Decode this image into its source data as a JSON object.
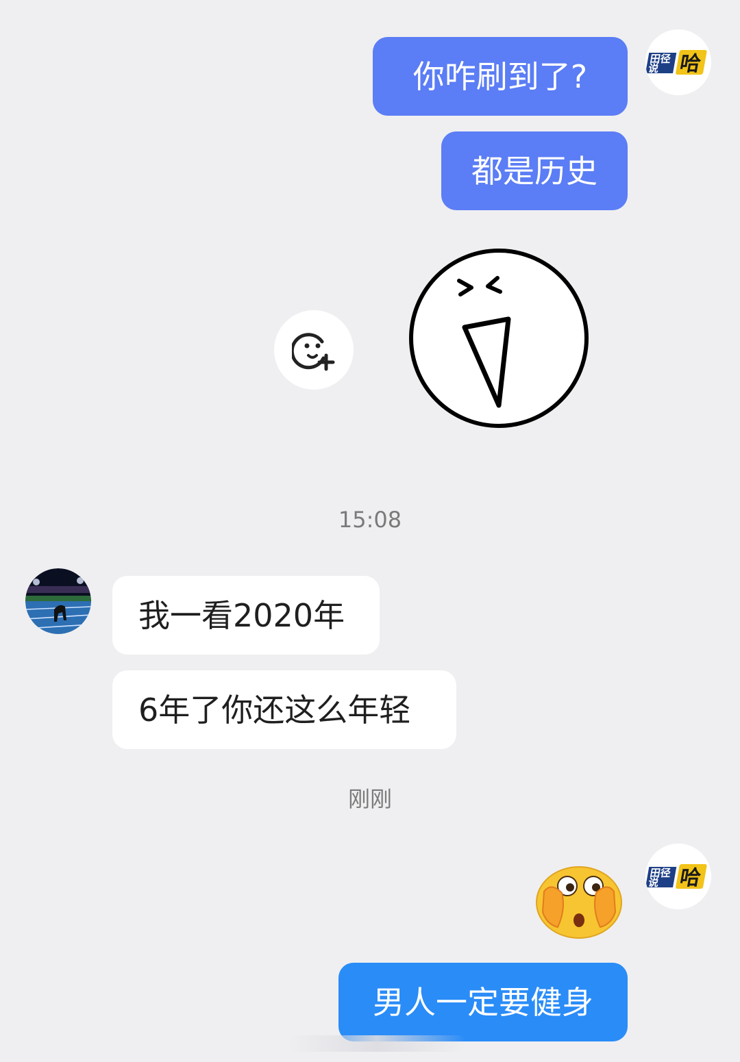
{
  "colors": {
    "background": "#efeff1",
    "my_bubble": "#5b7df5",
    "my_bubble_last": "#2a8cf7",
    "their_bubble": "#ffffff"
  },
  "messages": {
    "m1": "你咋刷到了?",
    "m2": "都是历史",
    "m3": "我一看2020年",
    "m4": "6年了你还这么年轻",
    "m5": "男人一定要健身"
  },
  "timestamps": {
    "t1": "15:08",
    "t2": "刚刚"
  },
  "icons": {
    "sticker": "laughing-face-sticker",
    "add_emoji": "add-sticker-icon",
    "reaction": "shy-covering-eyes-emoji"
  },
  "avatars": {
    "me_logo_text": "田径说哈",
    "other": "track-runner-photo"
  }
}
